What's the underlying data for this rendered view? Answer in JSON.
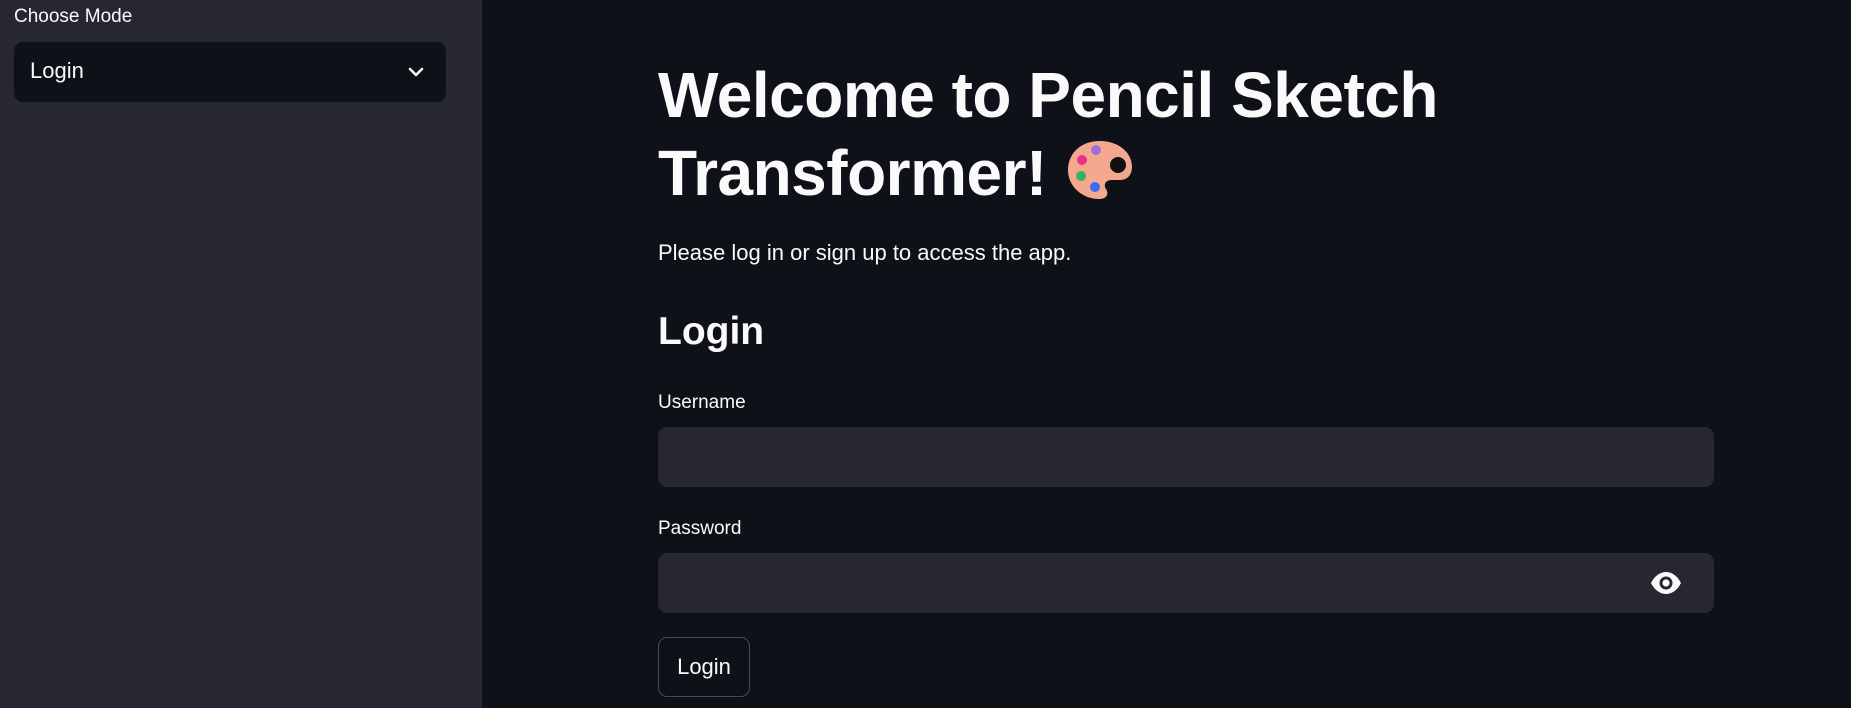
{
  "sidebar": {
    "mode_label": "Choose Mode",
    "mode_select": {
      "selected": "Login",
      "icon": "chevron-down-icon"
    }
  },
  "main": {
    "title": "Welcome to Pencil Sketch Transformer!",
    "title_icon": "artist-palette-icon",
    "subtitle": "Please log in or sign up to access the app.",
    "section_heading": "Login",
    "username": {
      "label": "Username",
      "value": "",
      "placeholder": ""
    },
    "password": {
      "label": "Password",
      "value": "",
      "placeholder": "",
      "toggle_icon": "eye-icon"
    },
    "submit_label": "Login"
  },
  "colors": {
    "background": "#0e1117",
    "sidebar_background": "#262730",
    "input_background": "#262730",
    "text": "#fafafa"
  }
}
